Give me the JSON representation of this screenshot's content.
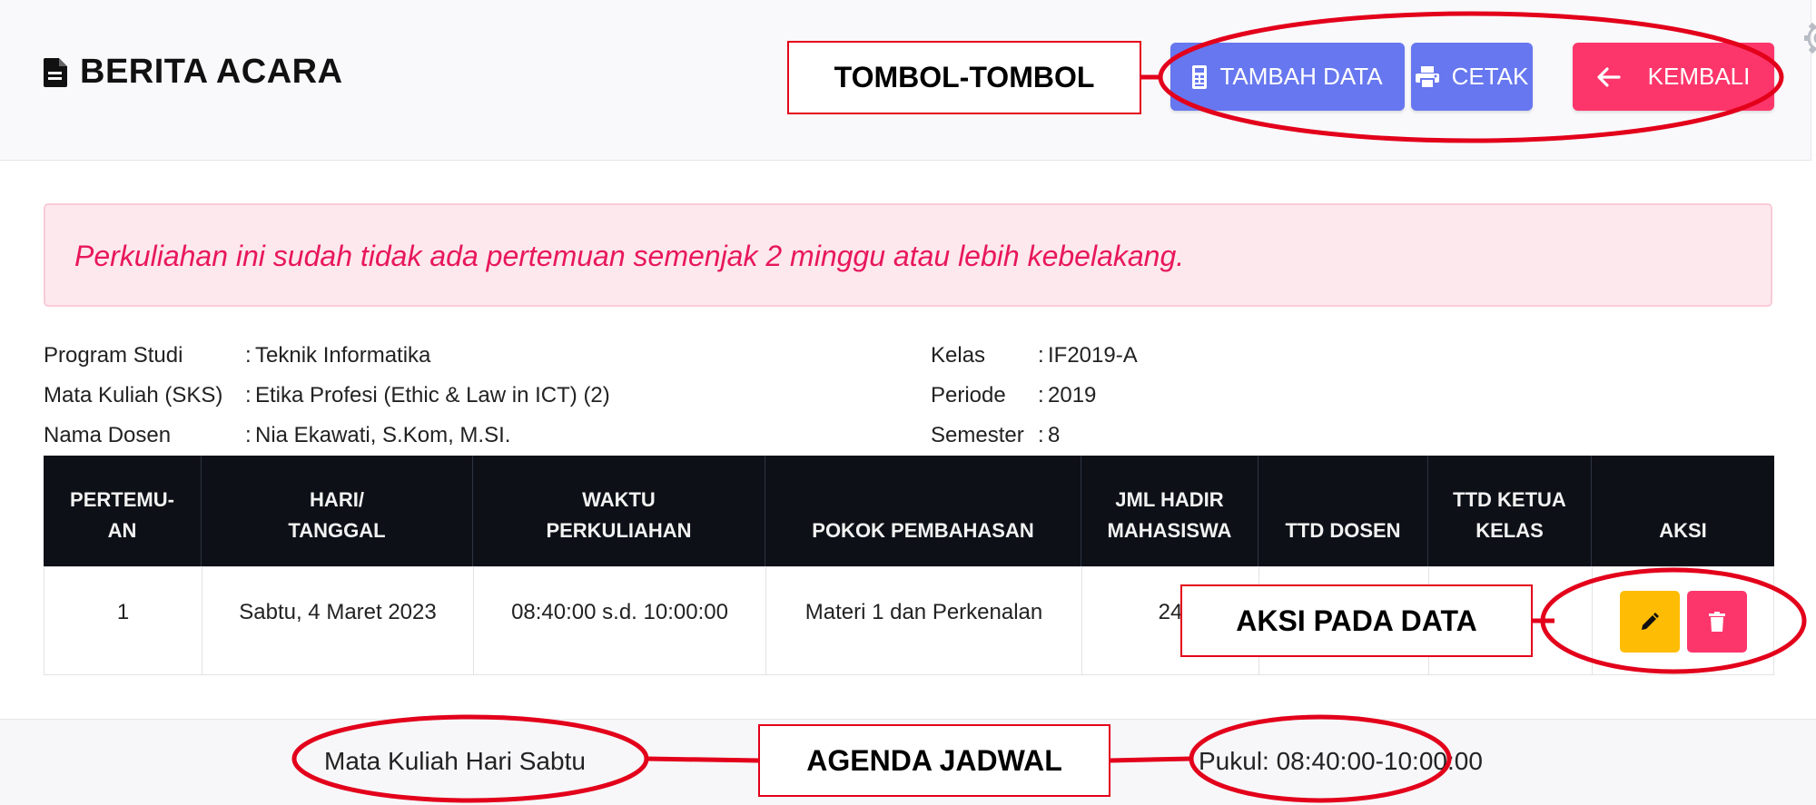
{
  "header": {
    "title": "BERITA ACARA",
    "buttons": {
      "tambah": "TAMBAH DATA",
      "cetak": "CETAK",
      "kembali": "KEMBALI"
    }
  },
  "alert": {
    "message": "Perkuliahan ini sudah tidak ada pertemuan semenjak 2 minggu atau lebih kebelakang."
  },
  "info": {
    "program_studi": {
      "label": "Program Studi",
      "value": "Teknik Informatika"
    },
    "mata_kuliah": {
      "label": "Mata Kuliah (SKS)",
      "value": "Etika Profesi (Ethic & Law in ICT) (2)"
    },
    "nama_dosen": {
      "label": "Nama Dosen",
      "value": "Nia Ekawati, S.Kom, M.SI."
    },
    "kelas": {
      "label": "Kelas",
      "value": "IF2019-A"
    },
    "periode": {
      "label": "Periode",
      "value": "2019"
    },
    "semester": {
      "label": "Semester",
      "value": "8"
    },
    "separator": ":"
  },
  "table": {
    "headers": {
      "pertemuan": "PERTEMU-\nAN",
      "hari": "HARI/\nTANGGAL",
      "waktu": "WAKTU\nPERKULIAHAN",
      "pokok": "POKOK PEMBAHASAN",
      "jml": "JML HADIR\nMAHASISWA",
      "ttd_dosen": "TTD DOSEN",
      "ttd_ketua": "TTD KETUA\nKELAS",
      "aksi": "AKSI"
    },
    "rows": [
      {
        "pertemuan": "1",
        "hari": "Sabtu, 4 Maret 2023",
        "waktu": "08:40:00 s.d. 10:00:00",
        "pokok": "Materi 1 dan Perkenalan",
        "jml": "24"
      }
    ]
  },
  "footer": {
    "left": "Mata Kuliah Hari Sabtu",
    "right": "Pukul: 08:40:00-10:00:00"
  },
  "annotations": {
    "tombol": "TOMBOL-TOMBOL",
    "aksi": "AKSI PADA DATA",
    "agenda": "AGENDA JADWAL"
  },
  "colors": {
    "primary": "#6777ef",
    "danger": "#fc366b",
    "warning": "#ffbc05",
    "annotation_red": "#e3001b",
    "table_header": "#0d1117"
  }
}
